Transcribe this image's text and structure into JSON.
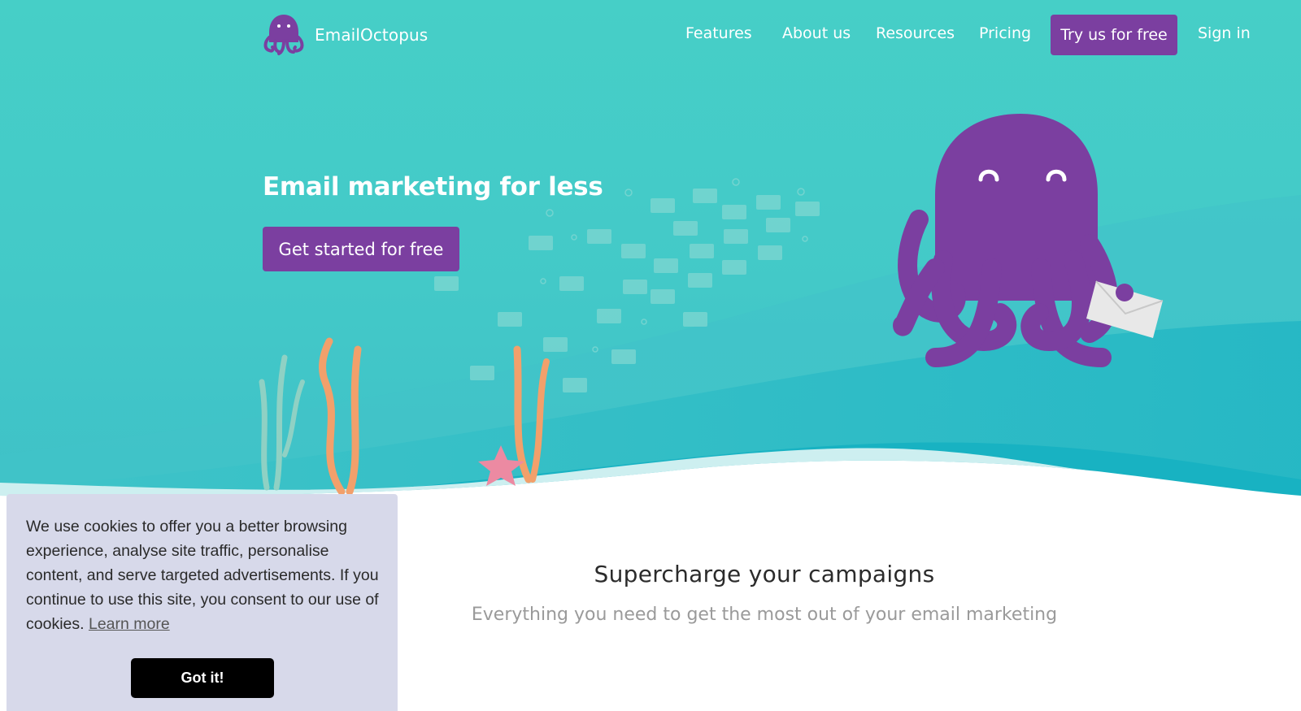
{
  "brand": {
    "name": "EmailOctopus",
    "logo_icon": "octopus-icon",
    "accent": "#7b3fa0",
    "hero_bg": "#46cfc7"
  },
  "nav": {
    "items": [
      "Features",
      "About us",
      "Resources",
      "Pricing"
    ],
    "cta": "Try us for free",
    "sign_in": "Sign in"
  },
  "hero": {
    "title": "Email marketing for less",
    "cta": "Get started for free"
  },
  "features": {
    "title": "Supercharge your campaigns",
    "subtitle": "Everything you need to get the most out of your email marketing"
  },
  "cookie": {
    "text": "We use cookies to offer you a better browsing experience, analyse site traffic, personalise content, and serve targeted advertisements. If you continue to use this site, you consent to our use of cookies.",
    "link": "Learn more",
    "button": "Got it!"
  }
}
